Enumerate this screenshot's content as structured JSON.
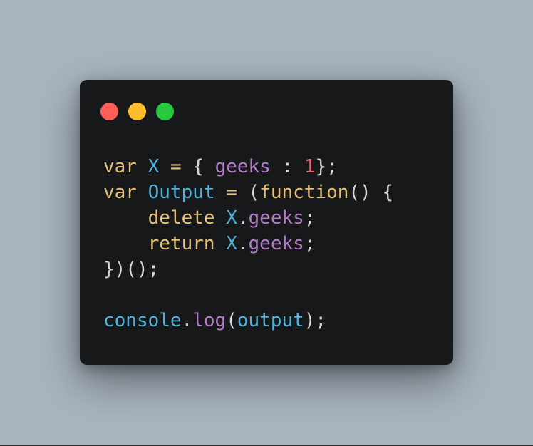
{
  "window": {
    "controls": [
      "close",
      "minimize",
      "maximize"
    ]
  },
  "code": {
    "lines": [
      [
        {
          "t": "var",
          "c": "kw"
        },
        {
          "t": " ",
          "c": "pun"
        },
        {
          "t": "X",
          "c": "id"
        },
        {
          "t": " ",
          "c": "pun"
        },
        {
          "t": "=",
          "c": "op"
        },
        {
          "t": " { ",
          "c": "pun"
        },
        {
          "t": "geeks",
          "c": "prop"
        },
        {
          "t": " : ",
          "c": "pun"
        },
        {
          "t": "1",
          "c": "num"
        },
        {
          "t": "};",
          "c": "pun"
        }
      ],
      [
        {
          "t": "var",
          "c": "kw"
        },
        {
          "t": " ",
          "c": "pun"
        },
        {
          "t": "Output",
          "c": "id"
        },
        {
          "t": " ",
          "c": "pun"
        },
        {
          "t": "=",
          "c": "op"
        },
        {
          "t": " (",
          "c": "pun"
        },
        {
          "t": "function",
          "c": "fn"
        },
        {
          "t": "() {",
          "c": "pun"
        }
      ],
      [
        {
          "t": "    ",
          "c": "pun"
        },
        {
          "t": "delete",
          "c": "kw"
        },
        {
          "t": " ",
          "c": "pun"
        },
        {
          "t": "X",
          "c": "id"
        },
        {
          "t": ".",
          "c": "pun"
        },
        {
          "t": "geeks",
          "c": "prop"
        },
        {
          "t": ";",
          "c": "pun"
        }
      ],
      [
        {
          "t": "    ",
          "c": "pun"
        },
        {
          "t": "return",
          "c": "kw"
        },
        {
          "t": " ",
          "c": "pun"
        },
        {
          "t": "X",
          "c": "id"
        },
        {
          "t": ".",
          "c": "pun"
        },
        {
          "t": "geeks",
          "c": "prop"
        },
        {
          "t": ";",
          "c": "pun"
        }
      ],
      [
        {
          "t": "})();",
          "c": "pun"
        }
      ],
      [],
      [
        {
          "t": "console",
          "c": "id"
        },
        {
          "t": ".",
          "c": "pun"
        },
        {
          "t": "log",
          "c": "prop"
        },
        {
          "t": "(",
          "c": "pun"
        },
        {
          "t": "output",
          "c": "id"
        },
        {
          "t": ");",
          "c": "pun"
        }
      ]
    ]
  },
  "colors": {
    "background": "#a9b4bf",
    "window": "#17181a",
    "keyword": "#e5c07b",
    "identifier": "#4fb3d9",
    "property": "#b07cc6",
    "number": "#e06c75",
    "text": "#d8d8d8",
    "close": "#ff5f56",
    "minimize": "#ffbd2e",
    "maximize": "#27c93f"
  }
}
